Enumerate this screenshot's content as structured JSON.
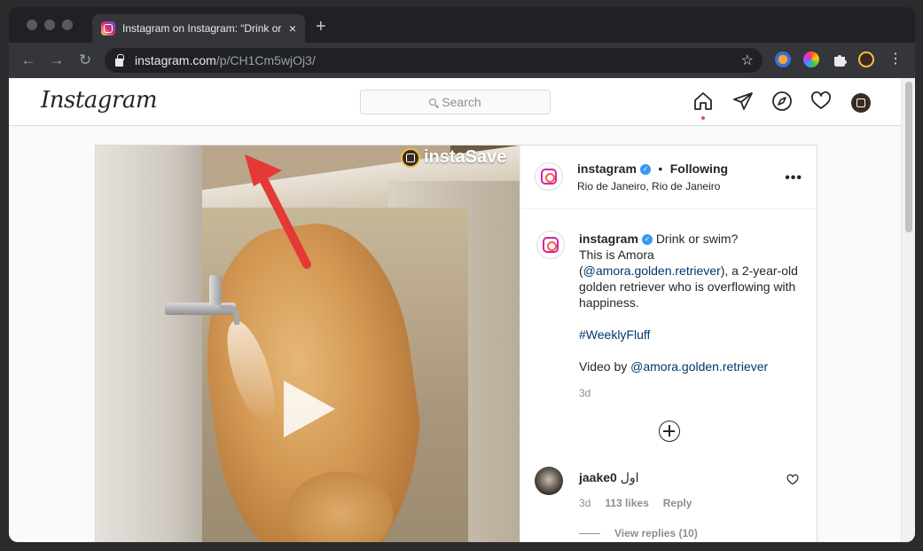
{
  "browser": {
    "tab_title": "Instagram on Instagram: “Drink or swim?",
    "tab_close": "×",
    "new_tab": "+",
    "url_host": "instagram.com",
    "url_path": "/p/CH1Cm5wjOj3/",
    "back": "←",
    "forward": "→",
    "reload": "↻",
    "star": "☆",
    "menu": "⋮"
  },
  "header": {
    "logo": "Instagram",
    "search_placeholder": "Search"
  },
  "post": {
    "watermark": "instaSave",
    "author": "instagram",
    "follow_separator": "•",
    "following": "Following",
    "location": "Rio de Janeiro, Rio de Janeiro",
    "more": "•••",
    "caption": {
      "author": "instagram",
      "line1": "Drink or swim?",
      "line2": "This is Amora",
      "open_paren": "(",
      "mention": "@amora.golden.retriever",
      "line3_rest": "), a 2-year-old golden retriever who is overflowing with happiness.",
      "hashtag": "#WeeklyFluff",
      "video_by": "Video by ",
      "mention2": "@amora.golden.retriever",
      "time": "3d"
    },
    "comment": {
      "username": "jaake0",
      "text": "اول",
      "time": "3d",
      "likes": "113 likes",
      "reply": "Reply",
      "view_replies": "View replies (10)"
    }
  },
  "colors": {
    "verified": "#3897f0",
    "link": "#00376b",
    "arrow": "#e53935",
    "notif": "#ed4956"
  }
}
